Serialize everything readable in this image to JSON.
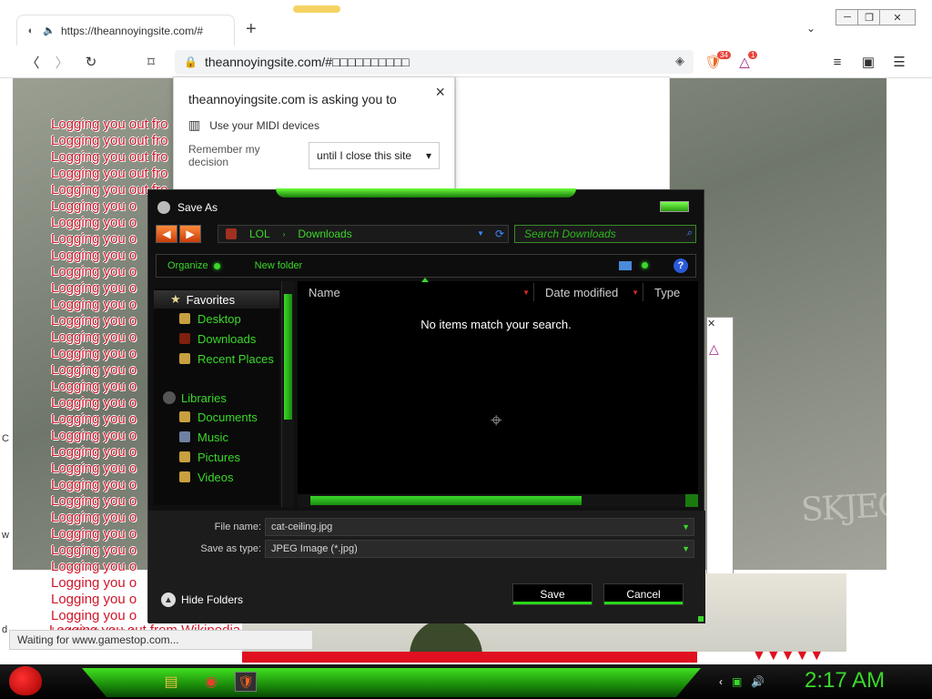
{
  "browser": {
    "tab_title": "https://theannoyingsite.com/#",
    "url": "theannoyingsite.com/#□□□□□□□□□□",
    "new_tab_symbol": "+",
    "shields_count": "34",
    "rewards_count": "1",
    "window_controls": [
      "─",
      "❐",
      "✕"
    ]
  },
  "permission": {
    "title": "theannoyingsite.com is asking you to",
    "request": "Use your MIDI devices",
    "remember_label": "Remember my decision",
    "remember_value": "until I close this site",
    "close_symbol": "×"
  },
  "page": {
    "logout_text": "Logging you out fro",
    "logout_text_short": "Logging you o",
    "logout_last": "Logging you out from Wikipedia",
    "watermark": "SKJECHA"
  },
  "dialog": {
    "title": "Save As",
    "breadcrumb": [
      "LOL",
      "Downloads"
    ],
    "search_placeholder": "Search Downloads",
    "organize": "Organize",
    "new_folder": "New folder",
    "help": "?",
    "favorites": "Favorites",
    "favorite_items": [
      "Desktop",
      "Downloads",
      "Recent Places"
    ],
    "libraries": "Libraries",
    "library_items": [
      "Documents",
      "Music",
      "Pictures",
      "Videos"
    ],
    "columns": [
      "Name",
      "Date modified",
      "Type"
    ],
    "empty_message": "No items match your search.",
    "file_name_label": "File name:",
    "file_name_value": "cat-ceiling.jpg",
    "save_type_label": "Save as type:",
    "save_type_value": "JPEG Image (*.jpg)",
    "hide_folders": "Hide Folders",
    "save_button": "Save",
    "cancel_button": "Cancel"
  },
  "status": {
    "text": "Waiting for www.gamestop.com..."
  },
  "taskbar": {
    "clock": "2:17 AM"
  }
}
